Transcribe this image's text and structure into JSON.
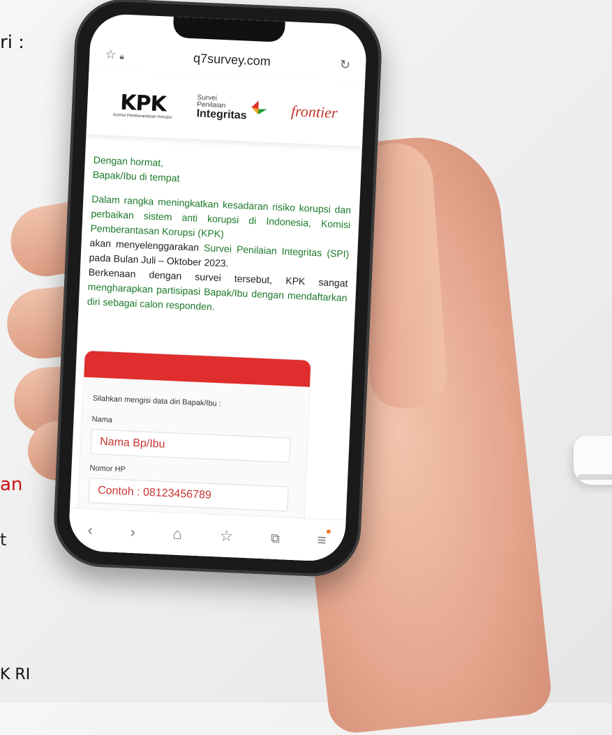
{
  "edge_text": {
    "top": "ri :",
    "red": "an",
    "middle": "t",
    "bottom": "K RI"
  },
  "browser": {
    "url": "q7survey.com",
    "icons": [
      "star-icon",
      "lock-icon",
      "reload-icon"
    ]
  },
  "logos": {
    "kpk_word": "KPK",
    "kpk_sub": "Komisi Pemberantasan Korupsi",
    "spi_line1": "Survei",
    "spi_line2": "Penilaian",
    "spi_line3": "Integritas",
    "frontier": "frontier"
  },
  "letter": {
    "greeting1": "Dengan hormat,",
    "greeting2": "Bapak/Ibu di tempat",
    "p1": "Dalam rangka meningkatkan kesadaran risiko korupsi dan perbaikan sistem anti korupsi di Indonesia, Komisi Pemberantasan Korupsi (KPK)",
    "p2a": "akan menyelenggarakan ",
    "p2b": "Survei Penilaian Integritas (SPI)",
    "p2c": " pada Bulan Juli – Oktober 2023.",
    "p3a": "Berkenaan dengan survei tersebut, KPK sangat ",
    "p3b": "mengharapkan partisipasi Bapak/Ibu dengan mendaftarkan diri sebagai calon responden."
  },
  "form": {
    "intro": "Silahkan mengisi data diri Bapak/Ibu :",
    "name_label": "Nama",
    "name_placeholder": "Nama Bp/Ibu",
    "phone_label": "Nomor HP",
    "phone_placeholder": "Contoh : 08123456789",
    "header_color": "#e02d2d"
  },
  "nav": {
    "icons": [
      "back-icon",
      "forward-icon",
      "home-icon",
      "bookmark-icon",
      "tabs-icon",
      "menu-icon"
    ]
  }
}
